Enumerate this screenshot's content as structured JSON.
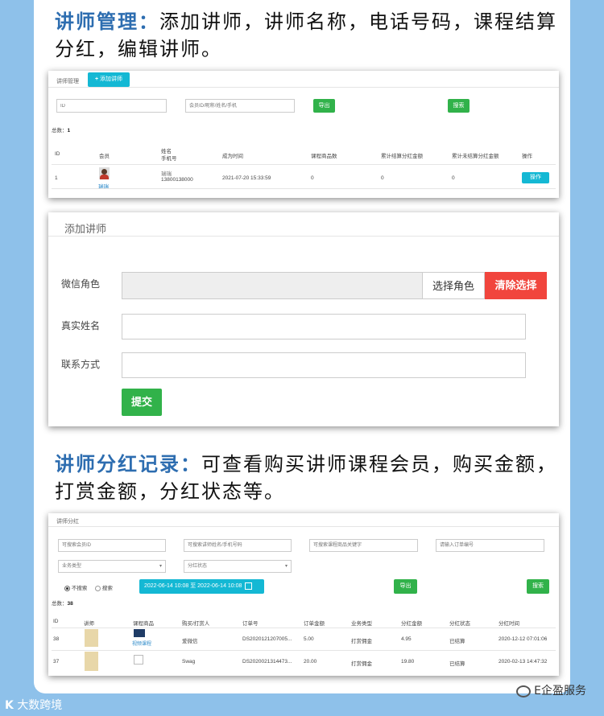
{
  "heading1": {
    "label": "讲师管理：",
    "text": "添加讲师，讲师名称，电话号码，课程结算分红，编辑讲师。"
  },
  "heading2": {
    "label": "讲师分红记录：",
    "text": "可查看购买讲师课程会员，购买金额，打赏金额，分红状态等。"
  },
  "panel1": {
    "tab_label": "讲师管理",
    "add_button": "添加讲师",
    "id_placeholder": "ID",
    "member_placeholder": "会员ID/昵称/姓名/手机",
    "export_label": "导出",
    "search_label": "搜索",
    "total_label": "总数：",
    "total_value": "1",
    "columns": {
      "id": "ID",
      "member": "会员",
      "name": "姓名",
      "phone": "手机号",
      "time": "成为时间",
      "count": "课程商品数",
      "settled": "累计结算分红金额",
      "unsettled": "累计未结算分红金额",
      "op": "操作"
    },
    "row": {
      "id": "1",
      "member": "瑞瑞",
      "name": "瑞瑞",
      "phone": "13800138000",
      "time": "2021-07-20 15:33:59",
      "count": "0",
      "settled": "0",
      "unsettled": "0",
      "op": "操作"
    }
  },
  "panel2": {
    "title": "添加讲师",
    "wechat_label": "微信角色",
    "select_role": "选择角色",
    "clear_select": "清除选择",
    "name_label": "真实姓名",
    "contact_label": "联系方式",
    "submit": "提交"
  },
  "panel3": {
    "tab_label": "讲师分红",
    "ph1": "可搜索会员ID",
    "ph2": "可搜索讲师姓名/手机号码",
    "ph3": "可搜索课程商品关键字",
    "ph4": "请输入订单编号",
    "select1": "业务类型",
    "select2": "分红状态",
    "radio1": "不搜索",
    "radio2": "搜索",
    "date_range": "2022-06-14 10:08 至 2022-06-14 10:08",
    "export_label": "导出",
    "search_label": "搜索",
    "total_label": "总数：",
    "total_value": "38",
    "columns": {
      "id": "ID",
      "lecturer": "讲师",
      "course": "课程商品",
      "buyer": "购买/打赏人",
      "order": "订单号",
      "amount": "订单金额",
      "type": "业务类型",
      "bonus": "分红金额",
      "status": "分红状态",
      "time": "分红时间"
    },
    "rows": [
      {
        "id": "38",
        "course": "视频课程",
        "buyer": "爱微信",
        "order": "DS2020121207005...",
        "amount": "5.00",
        "type": "打赏佣金",
        "bonus": "4.95",
        "status": "已结算",
        "time": "2020-12-12 07:01:06"
      },
      {
        "id": "37",
        "course": "",
        "buyer": "Swag",
        "order": "DS2020021314473...",
        "amount": "20.00",
        "type": "打赏佣金",
        "bonus": "19.80",
        "status": "已结算",
        "time": "2020-02-13 14:47:32"
      }
    ]
  },
  "footer": {
    "left": "大数跨境",
    "right": "E企盈服务"
  }
}
